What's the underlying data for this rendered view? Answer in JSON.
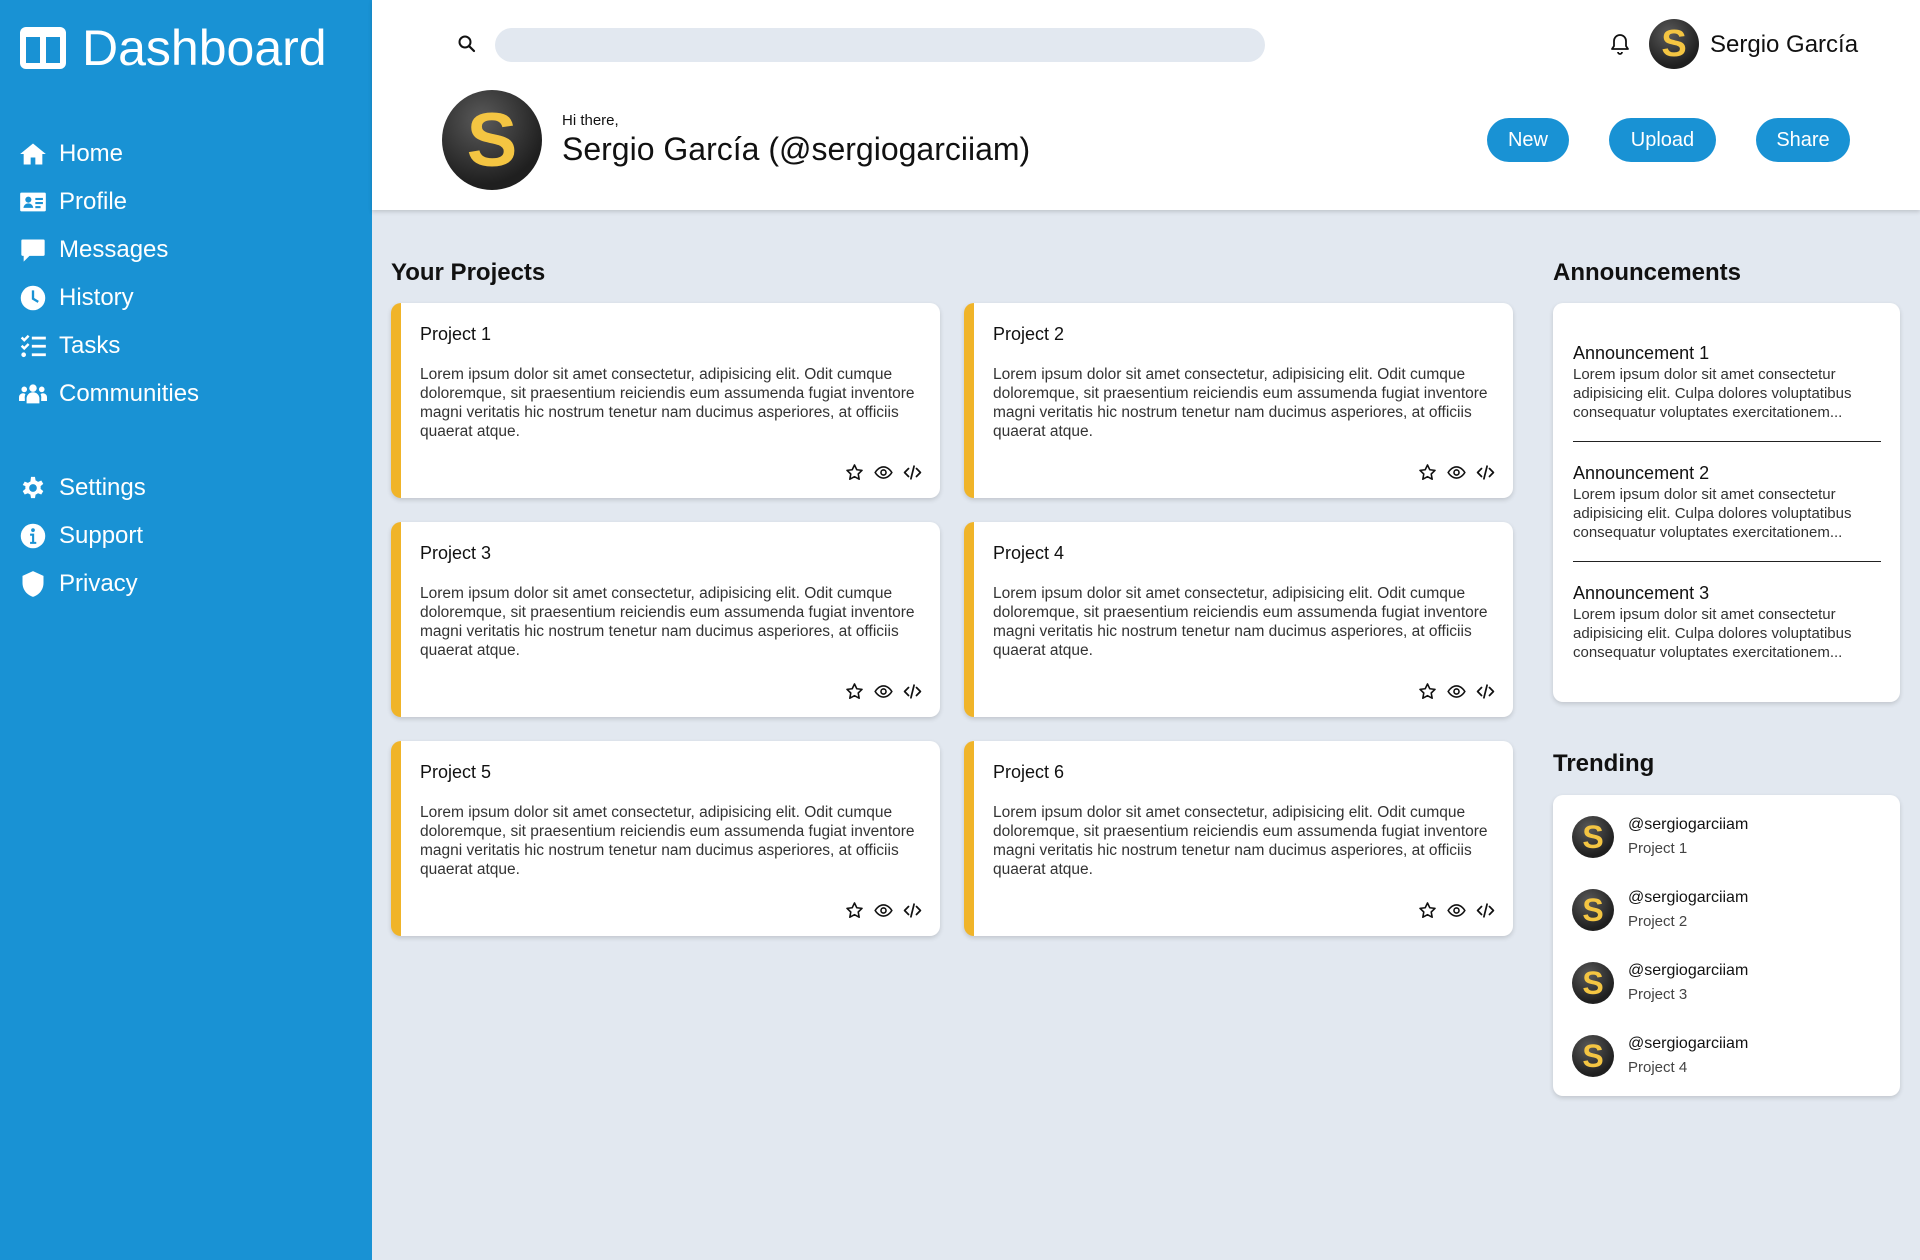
{
  "sidebar": {
    "brand_title": "Dashboard",
    "main_items": [
      {
        "label": "Home",
        "icon": "home-icon"
      },
      {
        "label": "Profile",
        "icon": "id-card-icon"
      },
      {
        "label": "Messages",
        "icon": "message-icon"
      },
      {
        "label": "History",
        "icon": "clock-icon"
      },
      {
        "label": "Tasks",
        "icon": "tasks-icon"
      },
      {
        "label": "Communities",
        "icon": "users-icon"
      }
    ],
    "secondary_items": [
      {
        "label": "Settings",
        "icon": "gear-icon"
      },
      {
        "label": "Support",
        "icon": "info-icon"
      },
      {
        "label": "Privacy",
        "icon": "shield-icon"
      }
    ]
  },
  "header": {
    "search_placeholder": "",
    "user_name": "Sergio García",
    "avatar_letter": "S",
    "greeting": "Hi there,",
    "full_name": "Sergio García (@sergiogarciiam)",
    "buttons": {
      "new": "New",
      "upload": "Upload",
      "share": "Share"
    }
  },
  "projects": {
    "title": "Your Projects",
    "items": [
      {
        "title": "Project 1",
        "description": "Lorem ipsum dolor sit amet consectetur, adipisicing elit. Odit cumque doloremque, sit praesentium reiciendis eum assumenda fugiat inventore magni veritatis hic nostrum tenetur nam ducimus asperiores, at officiis quaerat atque."
      },
      {
        "title": "Project 2",
        "description": "Lorem ipsum dolor sit amet consectetur, adipisicing elit. Odit cumque doloremque, sit praesentium reiciendis eum assumenda fugiat inventore magni veritatis hic nostrum tenetur nam ducimus asperiores, at officiis quaerat atque."
      },
      {
        "title": "Project 3",
        "description": "Lorem ipsum dolor sit amet consectetur, adipisicing elit. Odit cumque doloremque, sit praesentium reiciendis eum assumenda fugiat inventore magni veritatis hic nostrum tenetur nam ducimus asperiores, at officiis quaerat atque."
      },
      {
        "title": "Project 4",
        "description": "Lorem ipsum dolor sit amet consectetur, adipisicing elit. Odit cumque doloremque, sit praesentium reiciendis eum assumenda fugiat inventore magni veritatis hic nostrum tenetur nam ducimus asperiores, at officiis quaerat atque."
      },
      {
        "title": "Project 5",
        "description": "Lorem ipsum dolor sit amet consectetur, adipisicing elit. Odit cumque doloremque, sit praesentium reiciendis eum assumenda fugiat inventore magni veritatis hic nostrum tenetur nam ducimus asperiores, at officiis quaerat atque."
      },
      {
        "title": "Project 6",
        "description": "Lorem ipsum dolor sit amet consectetur, adipisicing elit. Odit cumque doloremque, sit praesentium reiciendis eum assumenda fugiat inventore magni veritatis hic nostrum tenetur nam ducimus asperiores, at officiis quaerat atque."
      }
    ],
    "action_icons": [
      "star-icon",
      "eye-icon",
      "code-icon"
    ]
  },
  "announcements": {
    "title": "Announcements",
    "items": [
      {
        "title": "Announcement 1",
        "body": "Lorem ipsum dolor sit amet consectetur adipisicing elit. Culpa dolores voluptatibus consequatur voluptates exercitationem..."
      },
      {
        "title": "Announcement 2",
        "body": "Lorem ipsum dolor sit amet consectetur adipisicing elit. Culpa dolores voluptatibus consequatur voluptates exercitationem..."
      },
      {
        "title": "Announcement 3",
        "body": "Lorem ipsum dolor sit amet consectetur adipisicing elit. Culpa dolores voluptatibus consequatur voluptates exercitationem..."
      }
    ]
  },
  "trending": {
    "title": "Trending",
    "items": [
      {
        "handle": "@sergiogarciiam",
        "project": "Project 1"
      },
      {
        "handle": "@sergiogarciiam",
        "project": "Project 2"
      },
      {
        "handle": "@sergiogarciiam",
        "project": "Project 3"
      },
      {
        "handle": "@sergiogarciiam",
        "project": "Project 4"
      }
    ]
  },
  "colors": {
    "sidebar_bg": "#1992d4",
    "page_bg": "#e2e8f0",
    "card_accent": "#f0b429",
    "avatar_letter": "#f4c542",
    "button_bg": "#1992d4"
  }
}
